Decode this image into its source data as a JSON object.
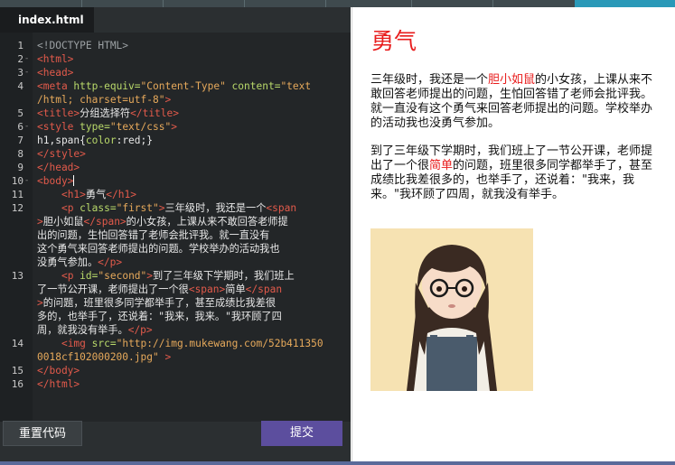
{
  "editor": {
    "tab_label": "index.html",
    "line_numbers": [
      "1",
      "2",
      "3",
      "4",
      "",
      "5",
      "6",
      "7",
      "8",
      "9",
      "10",
      "11",
      "12",
      "",
      "",
      "",
      "",
      "",
      "13",
      "",
      "",
      "",
      "",
      "14",
      "",
      "15",
      "16"
    ],
    "fold_markers": [
      "-",
      "-",
      "",
      "",
      "",
      "-",
      "",
      ""
    ],
    "code": {
      "l1": "<!DOCTYPE HTML>",
      "l2": "<html>",
      "l3": "<head>",
      "l4a_tag": "<meta",
      "l4a_attr1": " http-equiv=",
      "l4a_str1": "\"Content-Type\"",
      "l4a_attr2": " content=",
      "l4a_str2": "\"text",
      "l4b_str": "/html; charset=utf-8\"",
      "l4b_tag": ">",
      "l5_open": "<title>",
      "l5_text": "分组选择符",
      "l5_close": "</title>",
      "l6_tag": "<style",
      "l6_attr": " type=",
      "l6_str": "\"text/css\"",
      "l6_end": ">",
      "l7_sel": "h1,span{",
      "l7_prop": "color",
      "l7_rest": ":red;}",
      "l8": "</style>",
      "l9": "</head>",
      "l10": "<body>",
      "l11_open": "<h1>",
      "l11_text": "勇气",
      "l11_close": "</h1>",
      "l12a_tag": "<p",
      "l12a_attr": " class=",
      "l12a_str": "\"first\"",
      "l12a_end": ">",
      "l12a_text": "三年级时，我还是一个",
      "l12a_span": "<span",
      "l12b_end": ">",
      "l12b_text": "胆小如鼠",
      "l12b_close": "</span>",
      "l12b_text2": "的小女孩，上课从来不敢回答老师提",
      "l12c": "出的问题，生怕回答错了老师会批评我。就一直没有",
      "l12d": "这个勇气来回答老师提出的问题。学校举办的活动我也",
      "l12e_text": "没勇气参加。",
      "l12e_close": "</p>",
      "l13a_tag": "<p",
      "l13a_attr": " id=",
      "l13a_str": "\"second\"",
      "l13a_end": ">",
      "l13a_text": "到了三年级下学期时，我们班上",
      "l13b_text": "了一节公开课，老师提出了一个很",
      "l13b_open": "<span>",
      "l13b_text2": "简单",
      "l13b_close": "</span",
      "l13c_end": ">",
      "l13c_text": "的问题，班里很多同学都举手了，甚至成绩比我差很",
      "l13d": "多的，也举手了，还说着：\"我来，我来。\"我环顾了四",
      "l13e_text": "周，就我没有举手。",
      "l13e_close": "</p>",
      "l14a_tag": "<img",
      "l14a_attr": " src=",
      "l14a_str": "\"http://img.mukewang.com/52b411350",
      "l14b_str": "0018cf102000200.jpg\"",
      "l14b_end": " >",
      "l15": "</body>",
      "l16": "</html>"
    },
    "reset_label": "重置代码",
    "submit_label": "提交"
  },
  "preview": {
    "title": "勇气",
    "p1_before": "三年级时，我还是一个",
    "p1_red": "胆小如鼠",
    "p1_after": "的小女孩，上课从来不敢回答老师提出的问题，生怕回答错了老师会批评我。就一直没有这个勇气来回答老师提出的问题。学校举办的活动我也没勇气参加。",
    "p2_before": "到了三年级下学期时，我们班上了一节公开课，老师提出了一个很",
    "p2_red": "简单",
    "p2_after": "的问题，班里很多同学都举手了，甚至成绩比我差很多的，也举手了，还说着：\"我来，我来。\"我环顾了四周，就我没有举手。",
    "image_name": "girl-illustration"
  },
  "colors": {
    "accent_red": "#e81c1c",
    "submit_purple": "#5c4e9e",
    "editor_bg": "#232628"
  }
}
